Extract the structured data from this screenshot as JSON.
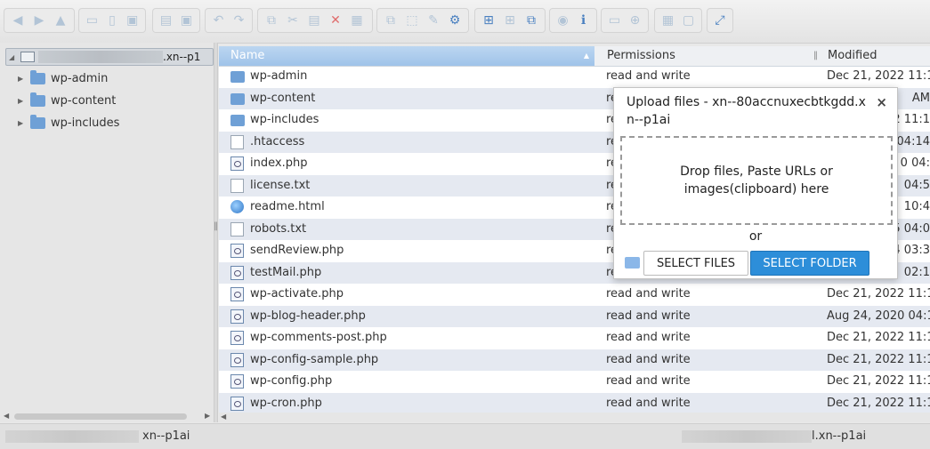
{
  "toolbar": {
    "groups": [
      {
        "buttons": [
          "back-icon",
          "forward-icon",
          "up-icon"
        ]
      },
      {
        "buttons": [
          "new-folder-icon",
          "new-file-icon",
          "save-icon"
        ]
      },
      {
        "buttons": [
          "open-icon",
          "save-as-icon"
        ]
      },
      {
        "buttons": [
          "undo-icon",
          "redo-icon"
        ]
      },
      {
        "buttons": [
          "copy-icon",
          "cut-icon",
          "paste-icon",
          "delete-icon",
          "empty-icon"
        ]
      },
      {
        "buttons": [
          "duplicate-icon",
          "select-icon",
          "edit-icon",
          "extract-icon"
        ]
      },
      {
        "buttons": [
          "icons-view-icon",
          "list-view-icon",
          "columns-view-icon"
        ]
      },
      {
        "buttons": [
          "preview-icon",
          "info-icon"
        ]
      },
      {
        "buttons": [
          "resize-icon",
          "upload-icon"
        ]
      },
      {
        "buttons": [
          "grid-icon",
          "text-icon"
        ]
      },
      {
        "buttons": [
          "fullscreen-icon"
        ]
      }
    ]
  },
  "tree": {
    "root_suffix": ".xn--p1",
    "items": [
      {
        "label": "wp-admin"
      },
      {
        "label": "wp-content"
      },
      {
        "label": "wp-includes"
      }
    ]
  },
  "files": {
    "columns": {
      "name": "Name",
      "permissions": "Permissions",
      "modified": "Modified"
    },
    "rows": [
      {
        "name": "wp-admin",
        "type": "folder",
        "permissions": "read and write",
        "modified": "Dec 21, 2022 11:1"
      },
      {
        "name": "wp-content",
        "type": "folder",
        "permissions": "re",
        "modified": "AM"
      },
      {
        "name": "wp-includes",
        "type": "folder",
        "permissions": "re",
        "modified": "2 11:1"
      },
      {
        "name": ".htaccess",
        "type": "file",
        "permissions": "re",
        "modified": "04:14"
      },
      {
        "name": "index.php",
        "type": "php",
        "permissions": "re",
        "modified": "0 04:"
      },
      {
        "name": "license.txt",
        "type": "file",
        "permissions": "re",
        "modified": "04:5"
      },
      {
        "name": "readme.html",
        "type": "html",
        "permissions": "re",
        "modified": "10:4"
      },
      {
        "name": "robots.txt",
        "type": "file",
        "permissions": "re",
        "modified": "5 04:0"
      },
      {
        "name": "sendReview.php",
        "type": "php",
        "permissions": "re",
        "modified": "4 03:3"
      },
      {
        "name": "testMail.php",
        "type": "php",
        "permissions": "re",
        "modified": "02:1"
      },
      {
        "name": "wp-activate.php",
        "type": "php",
        "permissions": "read and write",
        "modified": "Dec 21, 2022 11:1"
      },
      {
        "name": "wp-blog-header.php",
        "type": "php",
        "permissions": "read and write",
        "modified": "Aug 24, 2020 04:1"
      },
      {
        "name": "wp-comments-post.php",
        "type": "php",
        "permissions": "read and write",
        "modified": "Dec 21, 2022 11:1"
      },
      {
        "name": "wp-config-sample.php",
        "type": "php",
        "permissions": "read and write",
        "modified": "Dec 21, 2022 11:1"
      },
      {
        "name": "wp-config.php",
        "type": "php",
        "permissions": "read and write",
        "modified": "Dec 21, 2022 11:1"
      },
      {
        "name": "wp-cron.php",
        "type": "php",
        "permissions": "read and write",
        "modified": "Dec 21, 2022 11:1"
      }
    ]
  },
  "status": {
    "left_suffix": "xn--p1ai",
    "right_suffix": "l.xn--p1ai"
  },
  "dialog": {
    "title": "Upload files - xn--80accnuxecbtkgdd.xn--p1ai",
    "close": "×",
    "dropzone": "Drop files, Paste URLs or images(clipboard) here",
    "or": "or",
    "select_files": "SELECT FILES",
    "select_folder": "SELECT FOLDER"
  },
  "colors": {
    "accent": "#2d8ed9",
    "header_selected": "#9fc3e9",
    "row_alt": "#e5e9f1",
    "folder": "#6fa0d6"
  }
}
